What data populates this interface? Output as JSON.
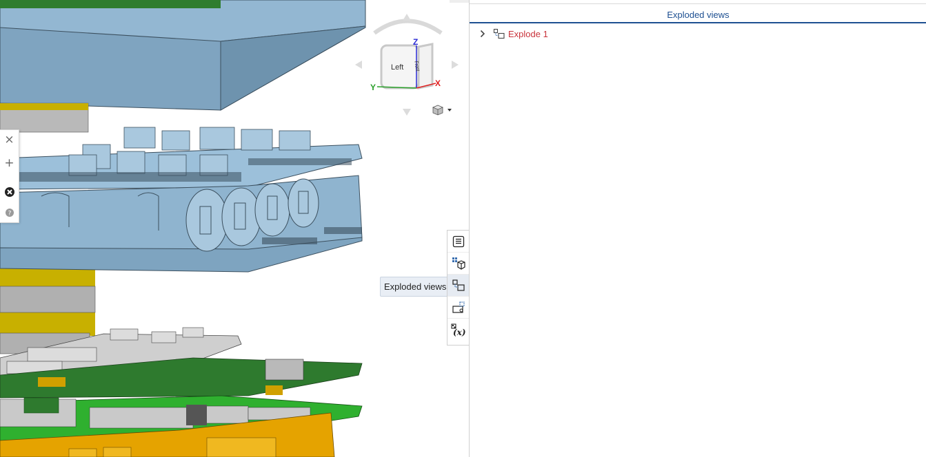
{
  "panel": {
    "title": "Exploded views",
    "tree": [
      {
        "label": "Explode 1",
        "icon": "explode-tree-icon",
        "expanded": false
      }
    ]
  },
  "tooltip": {
    "text": "Exploded views"
  },
  "view_cube": {
    "faces": {
      "left": "Left",
      "front": "Front"
    },
    "axes": {
      "x": "X",
      "y": "Y",
      "z": "Z"
    },
    "colors": {
      "x": "#e02020",
      "y": "#2aa02a",
      "z": "#2b2bd6"
    }
  },
  "toolbar": {
    "buttons": [
      {
        "icon": "feature-list-icon"
      },
      {
        "icon": "parts-instances-icon"
      },
      {
        "icon": "exploded-views-icon",
        "active": true
      },
      {
        "icon": "named-views-icon"
      },
      {
        "icon": "variables-icon"
      }
    ]
  },
  "colors": {
    "enclosure": "#8fb4cf",
    "pcb_green": "#2f7d2f",
    "component_gray": "#c4c4c4",
    "gold": "#e5a300",
    "accent_blue": "#1d4f91",
    "tree_red": "#c8323a"
  }
}
